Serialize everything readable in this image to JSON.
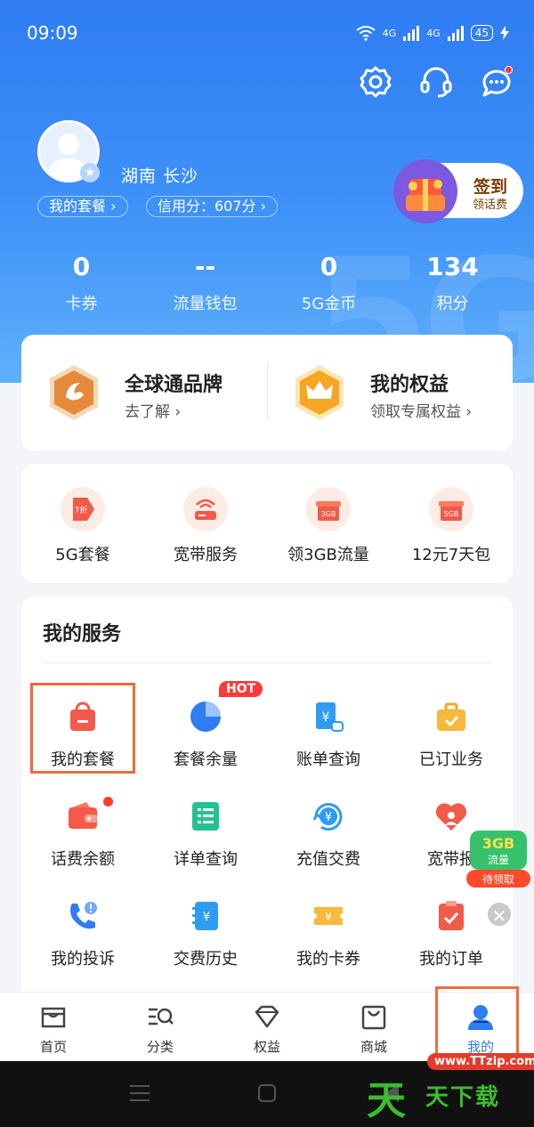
{
  "status_bar": {
    "time": "09:09",
    "network1": "4G",
    "network2": "4G",
    "battery": "45"
  },
  "profile": {
    "location": "湖南  长沙",
    "plan_pill": "我的套餐 ›",
    "credit_pill": "信用分：607分 ›"
  },
  "sign_in": {
    "title": "签到",
    "subtitle": "领话费"
  },
  "stats": [
    {
      "value": "0",
      "label": "卡券"
    },
    {
      "value": "--",
      "label": "流量钱包"
    },
    {
      "value": "0",
      "label": "5G金币"
    },
    {
      "value": "134",
      "label": "积分"
    }
  ],
  "brand": {
    "left": {
      "title": "全球通品牌",
      "sub": "去了解 ›"
    },
    "right": {
      "title": "我的权益",
      "sub": "领取专属权益 ›"
    }
  },
  "promos": [
    {
      "label": "5G套餐",
      "tag": "7折"
    },
    {
      "label": "宽带服务"
    },
    {
      "label": "领3GB流量",
      "tag": "3GB"
    },
    {
      "label": "12元7天包",
      "tag": "5GB"
    }
  ],
  "services": {
    "title": "我的服务",
    "hot_badge": "HOT",
    "items": [
      {
        "label": "我的套餐"
      },
      {
        "label": "套餐余量"
      },
      {
        "label": "账单查询"
      },
      {
        "label": "已订业务"
      },
      {
        "label": "话费余额"
      },
      {
        "label": "详单查询"
      },
      {
        "label": "充值交费"
      },
      {
        "label": "宽带报"
      },
      {
        "label": "我的投诉"
      },
      {
        "label": "交费历史"
      },
      {
        "label": "我的卡券"
      },
      {
        "label": "我的订单"
      }
    ]
  },
  "float_gift": {
    "line1": "3GB",
    "line2": "流量",
    "line3": "待领取"
  },
  "tabs": [
    {
      "label": "首页"
    },
    {
      "label": "分类"
    },
    {
      "label": "权益"
    },
    {
      "label": "商城"
    },
    {
      "label": "我的"
    }
  ],
  "watermark": {
    "url": "www.TTzip.com",
    "big": "天",
    "small": "天下载"
  },
  "colors": {
    "primary": "#2f7cf3",
    "highlight": "#f26a3d",
    "promo_red": "#f25a4a"
  }
}
